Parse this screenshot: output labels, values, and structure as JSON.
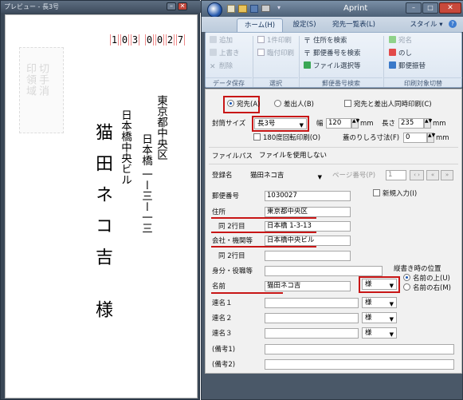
{
  "preview": {
    "title": "プレビュー  - 長3号",
    "zip_digits": [
      "1",
      "0",
      "3",
      "0",
      "0",
      "2",
      "7"
    ],
    "stamp_text": "切手消印領域",
    "address1": "東京都中央区",
    "address2": "日本橋 一ー三ー一三",
    "company": "日本橋中央ビル",
    "name": "猫田ネコ吉",
    "honorific": "様"
  },
  "window": {
    "title": "Aprint",
    "min": "–",
    "max": "□",
    "close": "✕"
  },
  "tabs": {
    "home": "ホーム(H)",
    "settings": "設定(S)",
    "recipients": "宛先一覧表(L)",
    "style": "スタイル ▾"
  },
  "ribbon": {
    "add": "追加",
    "overwrite": "上書き",
    "delete": "削除",
    "group_save": "データ保存",
    "print_one": "1件印刷",
    "print_temp": "臨付印刷",
    "group_select": "選択",
    "search_address": "住所を検索",
    "search_zip": "郵便番号を検索",
    "file_select": "ファイル選択等",
    "group_zip": "郵便番号検索",
    "recipient": "宛名",
    "noshi": "のし",
    "postal_transfer": "郵便振替",
    "group_target": "印刷対象切替"
  },
  "form": {
    "radio_recipient": "宛先(A)",
    "radio_sender": "差出人(B)",
    "check_same_time": "宛先と差出人同時印刷(C)",
    "envelope_size_label": "封筒サイズ",
    "envelope_size": "長3号",
    "width_label": "幅",
    "width_value": "120",
    "unit_mm": "mm",
    "length_label": "長さ",
    "length_value": "235",
    "rotate_label": "180度回転印刷(O)",
    "flap_label": "蓋のりしろ寸法(F)",
    "flap_value": "0",
    "filepath_label": "ファイルパス",
    "filepath_value": "ファイルを使用しない",
    "reg_name_label": "登録名",
    "reg_name_value": "猫田ネコ吉",
    "page_label": "ページ番号(P)",
    "page_value": "1",
    "zip_label": "郵便番号",
    "zip_value": "1030027",
    "new_entry_label": "新規入力(I)",
    "address_label": "住所",
    "address_value": "東京都中央区",
    "address2_label": "同 2行目",
    "address2_value": "日本橋 1-3-13",
    "company_label": "会社・機関等",
    "company_value": "日本橋中央ビル",
    "company2_label": "同 2行目",
    "company2_value": "",
    "title_label": "身分・役職等",
    "title_value": "",
    "vertical_pos_label": "縦書き時の位置",
    "pos_above": "名前の上(U)",
    "pos_right": "名前の右(M)",
    "name_label": "名前",
    "name_value": "猫田ネコ吉",
    "honorific": "様",
    "joint1_label": "連名１",
    "joint2_label": "連名２",
    "joint3_label": "連名３",
    "note1_label": "(備考1)",
    "note2_label": "(備考2)"
  },
  "colors": {
    "highlight": "#c81616",
    "ribbon": "#dce6f2"
  }
}
